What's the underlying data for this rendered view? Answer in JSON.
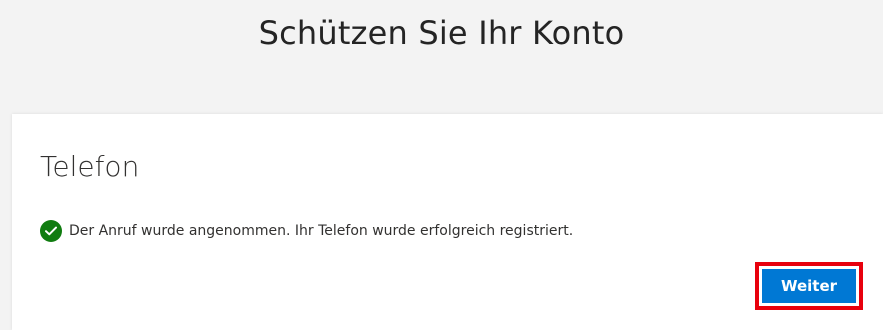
{
  "header": {
    "title": "Schützen Sie Ihr Konto"
  },
  "card": {
    "heading": "Telefon",
    "status_message": "Der Anruf wurde angenommen. Ihr Telefon wurde erfolgreich registriert.",
    "next_label": "Weiter"
  },
  "icons": {
    "status": "checkmark-circle-icon"
  },
  "colors": {
    "success": "#107c10",
    "primary_button": "#0078d4",
    "highlight_outline": "#e8000d"
  }
}
